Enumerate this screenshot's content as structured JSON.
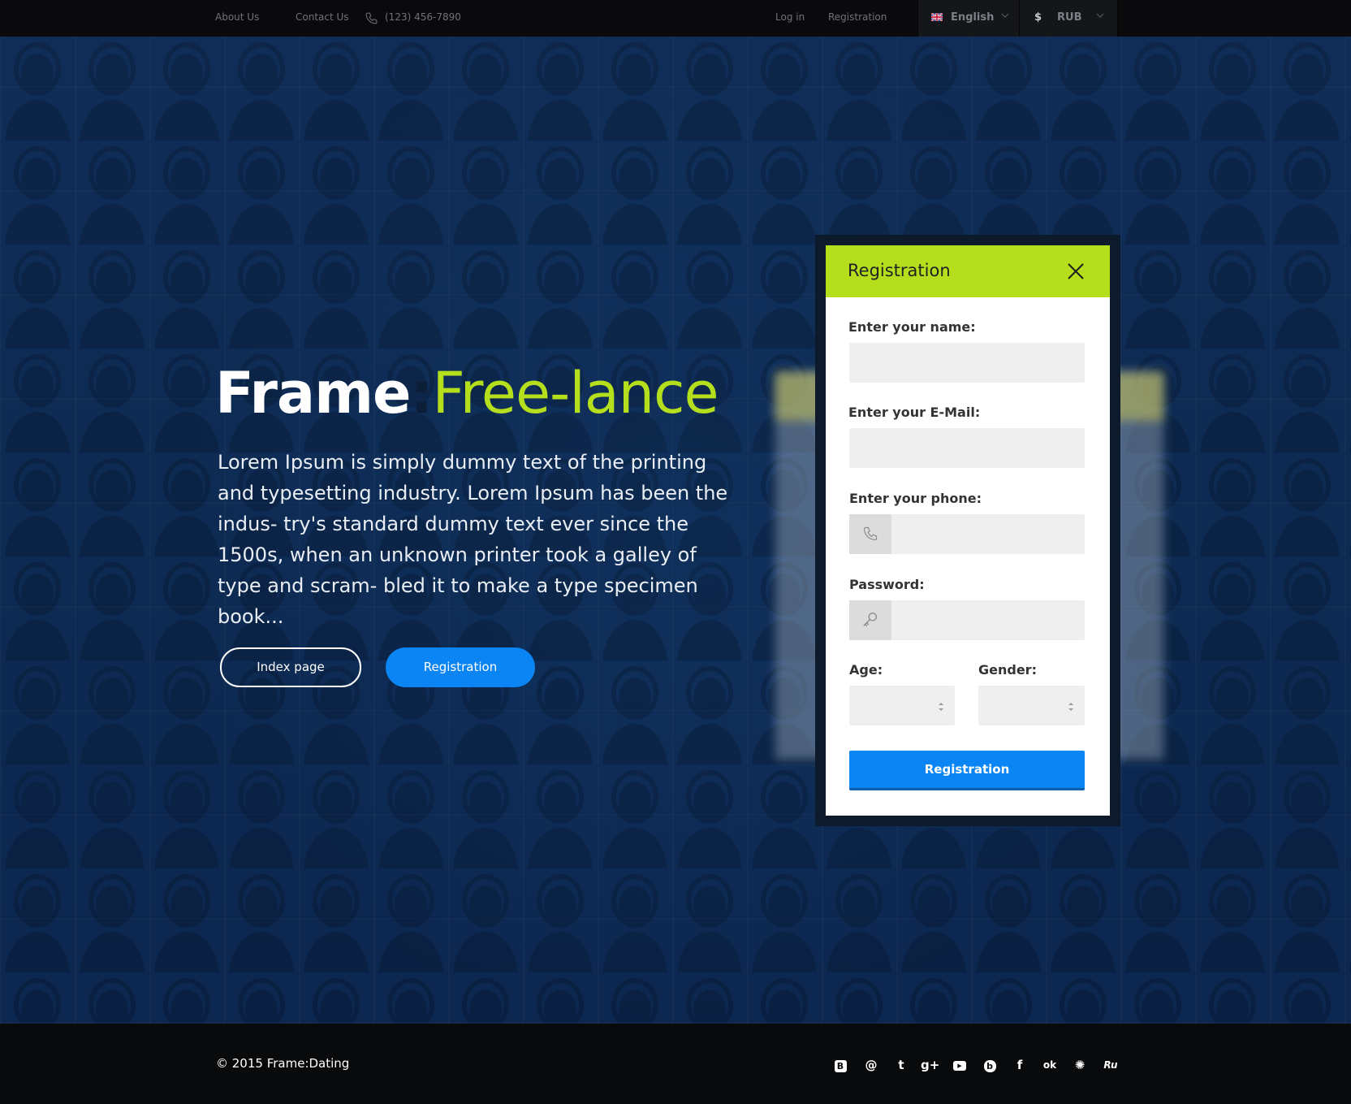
{
  "topbar": {
    "about": "About Us",
    "contact": "Contact Us",
    "phone": "(123) 456-7890",
    "login": "Log in",
    "registration": "Registration",
    "language": "English",
    "currency": "RUB",
    "currency_symbol": "$"
  },
  "hero": {
    "title_a": "Frame",
    "title_sep": ":",
    "title_b": "Free-lance",
    "text": "Lorem Ipsum is simply dummy text of the printing and typesetting industry. Lorem Ipsum has been the indus- try's standard dummy text ever since the 1500s, when an unknown printer took a galley of type and scram- bled it to make a type specimen book...",
    "btn_index": "Index page",
    "btn_registration": "Registration"
  },
  "modal": {
    "title": "Registration",
    "name_label": "Enter your name:",
    "email_label": "Enter your E-Mail:",
    "phone_label": "Enter your phone:",
    "password_label": "Password:",
    "age_label": "Age:",
    "gender_label": "Gender:",
    "submit": "Registration"
  },
  "footer": {
    "copyright": "© 2015 Frame:Dating",
    "social": [
      "B",
      "@",
      "t",
      "g+",
      "▶",
      "b",
      "f",
      "ok",
      "✺",
      "Ru"
    ]
  },
  "colors": {
    "accent_green": "#b5df1c",
    "accent_blue": "#0b85f3",
    "background": "#0c2a52"
  }
}
